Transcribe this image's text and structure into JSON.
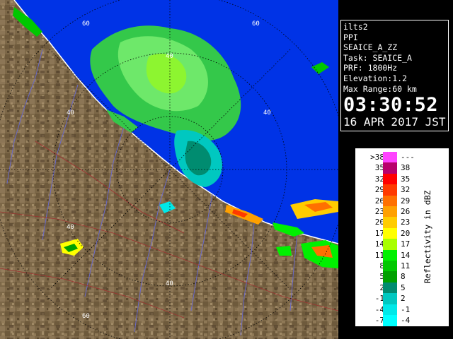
{
  "info": {
    "product": "ilts2",
    "scan_type": "PPI",
    "field": "SEAICE_A_ZZ",
    "task": "Task: SEAICE_A",
    "prf": "PRF: 1800Hz",
    "elevation": "Elevation:1.2",
    "max_range": "Max Range:60 km",
    "time": "03:30:52",
    "date": "16 APR 2017 JST"
  },
  "legend": {
    "unit_label": "Reflectivity in dBZ",
    "rows": [
      {
        "left": ">38",
        "right": "---",
        "color": "#ff44ff"
      },
      {
        "left": "35",
        "right": "38",
        "color": "#b8006c"
      },
      {
        "left": "32",
        "right": "35",
        "color": "#ff0000"
      },
      {
        "left": "29",
        "right": "32",
        "color": "#ff3a00"
      },
      {
        "left": "26",
        "right": "29",
        "color": "#ff7000"
      },
      {
        "left": "23",
        "right": "26",
        "color": "#ffa000"
      },
      {
        "left": "20",
        "right": "23",
        "color": "#ffcc00"
      },
      {
        "left": "17",
        "right": "20",
        "color": "#ffff00"
      },
      {
        "left": "14",
        "right": "17",
        "color": "#a8ff00"
      },
      {
        "left": "11",
        "right": "14",
        "color": "#00f000"
      },
      {
        "left": "8",
        "right": "11",
        "color": "#00c800"
      },
      {
        "left": "5",
        "right": "8",
        "color": "#00a000"
      },
      {
        "left": "2",
        "right": "5",
        "color": "#008c70"
      },
      {
        "left": "-1",
        "right": "2",
        "color": "#00c8c0"
      },
      {
        "left": "-4",
        "right": "-1",
        "color": "#00e8e8"
      },
      {
        "left": "-7",
        "right": "-4",
        "color": "#00ffff"
      }
    ]
  },
  "map": {
    "range_labels": [
      "60",
      "60",
      "40",
      "40",
      "40",
      "40",
      "40",
      "60"
    ],
    "colors": {
      "sea": "#0033e6",
      "land": "#806a4a",
      "coast": "#ffffff",
      "rivers": "#6a6ac8",
      "roads": "#a03030"
    }
  }
}
